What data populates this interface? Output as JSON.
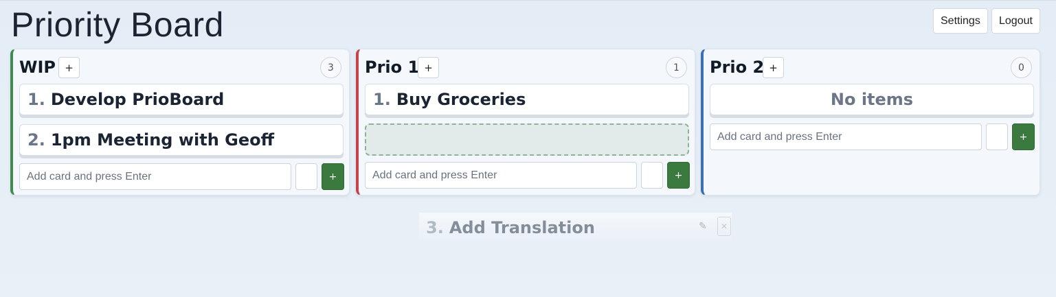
{
  "header": {
    "title": "Priority Board",
    "settings_label": "Settings",
    "logout_label": "Logout"
  },
  "columns": [
    {
      "title": "WIP",
      "accent": "#3e8d4f",
      "add_label": "+",
      "count": "3",
      "cards": [
        {
          "num": "1.",
          "text": "Develop PrioBoard"
        },
        {
          "num": "2.",
          "text": "1pm Meeting with Geoff"
        }
      ],
      "input_placeholder": "Add card and press Enter",
      "submit_label": "+"
    },
    {
      "title": "Prio 1",
      "accent": "#c7434b",
      "add_label": "+",
      "count": "1",
      "cards": [
        {
          "num": "1.",
          "text": "Buy Groceries"
        }
      ],
      "input_placeholder": "Add card and press Enter",
      "submit_label": "+"
    },
    {
      "title": "Prio 2",
      "accent": "#3d6fb5",
      "add_label": "+",
      "count": "0",
      "empty_text": "No items",
      "input_placeholder": "Add card and press Enter",
      "submit_label": "+"
    }
  ],
  "drag_ghost": {
    "num": "3.",
    "text": "Add Translation",
    "edit_icon": "✎",
    "close_icon": "✕"
  },
  "colors": {
    "button_green": "#3b7a3e",
    "placeholder_border": "#8fb199"
  }
}
